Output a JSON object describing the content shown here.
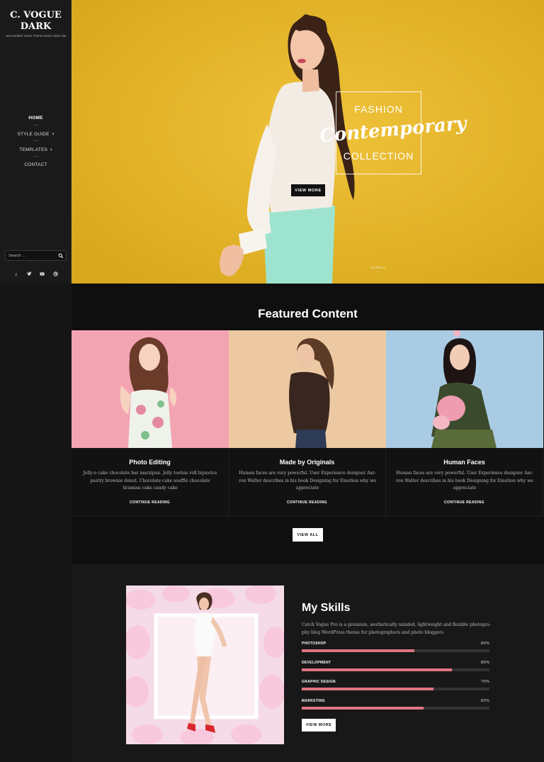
{
  "sidebar": {
    "site_title_line1": "C. VOGUE",
    "site_title_line2": "DARK",
    "tagline": "Just another Catch Theme Demo Sites site",
    "nav": [
      {
        "label": "HOME"
      },
      {
        "label": "STYLE GUIDE"
      },
      {
        "label": "TEMPLATES"
      },
      {
        "label": "CONTACT"
      }
    ],
    "search_placeholder": "Search ...",
    "social_icons": [
      "facebook-icon",
      "twitter-icon",
      "youtube-icon",
      "dribbble-icon"
    ]
  },
  "hero": {
    "line1": "FASHION",
    "line2": "Contemporary",
    "line3": "COLLECTION",
    "button": "VIEW MORE",
    "scroll_label": "SCROLL",
    "bg_color": "#e5b525"
  },
  "featured": {
    "title": "Featured Content",
    "cards": [
      {
        "title": "Photo Editing",
        "text": "Jelly-o cake chocolate bar marzipan. Jelly tootsie roll liquorice pastry brownie donut. Chocolate cake soufflé chocolate tiramisu cake candy cake",
        "link": "CONTINUE READING",
        "bg": "#f3a4b3"
      },
      {
        "title": "Made by Originals",
        "text": "Human faces are very powerful. User Experience designer Aar-ron Walter describes in his book Designing for Emotion why we appreciate",
        "link": "CONTINUE READING",
        "bg": "#ecc9a2"
      },
      {
        "title": "Human Faces",
        "text": "Human faces are very powerful. User Experience designer Aar-ron Walter describes in his book Designing for Emotion why we appreciate",
        "link": "CONTINUE READING",
        "bg": "#a9cbe4"
      }
    ],
    "view_all": "VIEW ALL"
  },
  "skills": {
    "title": "My Skills",
    "text": "Catch Vogue Pro is a premium, aesthetically minded, lightweight and flexible photogra-phy blog WordPress theme for photographers and photo bloggers",
    "items": [
      {
        "name": "PHOTOSHOP",
        "percent": 60,
        "label": "60%"
      },
      {
        "name": "DEVELOPMENT",
        "percent": 80,
        "label": "80%"
      },
      {
        "name": "GRAPHIC DESIGN",
        "percent": 70,
        "label": "70%"
      },
      {
        "name": "MARKETING",
        "percent": 65,
        "label": "65%"
      }
    ],
    "button": "VIEW MORE",
    "accent": "#e07484"
  }
}
